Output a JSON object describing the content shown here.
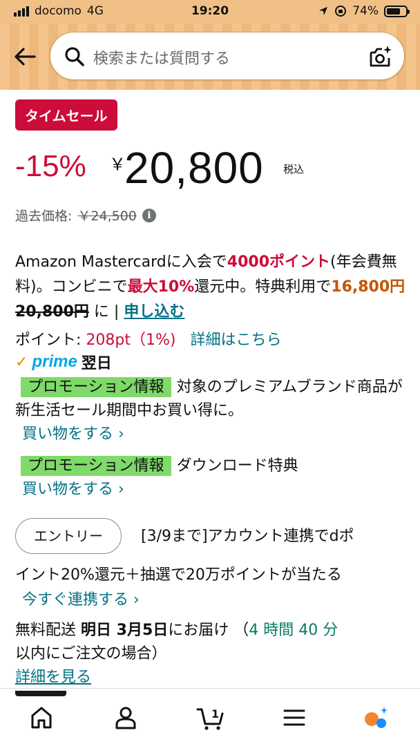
{
  "status_bar": {
    "carrier": "docomo",
    "network": "4G",
    "time": "19:20",
    "battery": "74%"
  },
  "header": {
    "search_placeholder": "検索または質問する"
  },
  "product": {
    "badge": "タイムセール",
    "discount": "-15%",
    "currency": "￥",
    "price": "20,800",
    "tax_label": "税込",
    "past_price_label": "過去価格:",
    "past_price": "￥24,500"
  },
  "card_promo": {
    "t1": "Amazon Mastercardに入会で",
    "points": "4000ポイント",
    "t2": "(年会費無料)。コンビニで",
    "max": "最大10%",
    "t3": "還元中。特典利用で",
    "new_price": "16,800円",
    "old_price": "20,800円",
    "t4": " に",
    "separator": " | ",
    "apply": "申し込む"
  },
  "points": {
    "label": "ポイント:",
    "value": "208pt（1%)",
    "details": "詳細はこちら"
  },
  "prime": {
    "check": "✓",
    "word": "prime",
    "day": "翌日"
  },
  "promos": [
    {
      "tag": "プロモーション情報",
      "text": "対象のプレミアムブランド商品が新生活セール期間中お買い得に。",
      "link": "買い物をする ›"
    },
    {
      "tag": "プロモーション情報",
      "text": "ダウンロード特典",
      "link": "買い物をする ›"
    }
  ],
  "entry": {
    "button": "エントリー",
    "text_line1": "[3/9まで]アカウント連携でdポ",
    "text_line2": "イント20%還元＋抽選で20万ポイントが当たる",
    "link": "今すぐ連携する ›"
  },
  "delivery": {
    "t1": "無料配送 ",
    "date": "明日 3月5日",
    "t2": "にお届け （",
    "countdown": "4 時間 40 分",
    "t3": "以内にご注文の場合）",
    "details": "詳細を見る"
  },
  "bottom_nav": {
    "cart_count": "1"
  },
  "colors": {
    "header_bg": "#f4c48c",
    "deal_red": "#cc0c39",
    "link": "#007185",
    "promo_green": "#7fda69"
  }
}
